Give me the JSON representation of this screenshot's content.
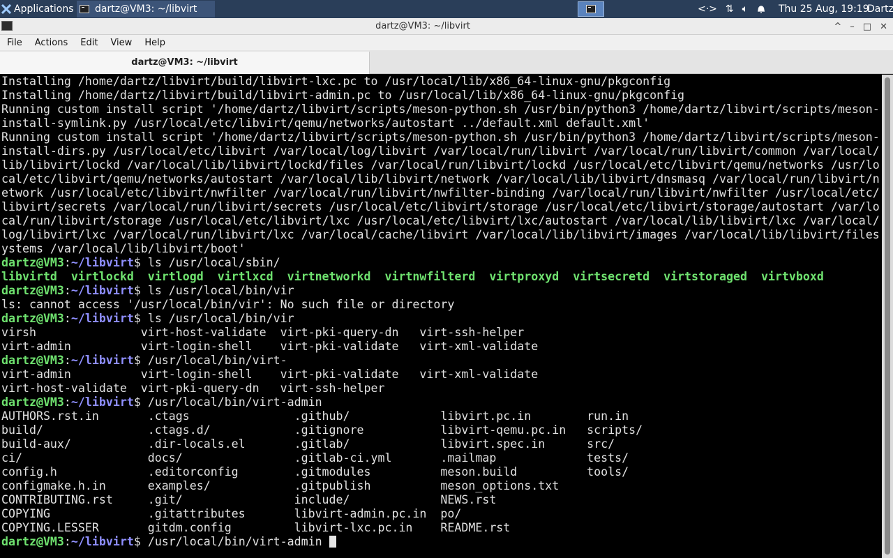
{
  "panel": {
    "apps_label": "Applications",
    "task_label": "dartz@VM3: ~/libvirt",
    "clock": "Thu 25 Aug, 19:19",
    "user": "Dartz",
    "tray_icons": [
      "network-arrows-icon",
      "updown-arrows-icon",
      "volume-icon",
      "bell-icon"
    ]
  },
  "window": {
    "title": "dartz@VM3: ~/libvirt",
    "btn_up": "^",
    "btn_min": "–",
    "btn_max": "□",
    "btn_close": "✕"
  },
  "menu": {
    "file": "File",
    "actions": "Actions",
    "edit": "Edit",
    "view": "View",
    "help": "Help"
  },
  "tab": {
    "label": "dartz@VM3: ~/libvirt"
  },
  "terminal": {
    "prompt_user": "dartz@VM3",
    "prompt_path": "~/libvirt",
    "lines": [
      {
        "kind": "out",
        "text": "Installing /home/dartz/libvirt/build/libvirt-lxc.pc to /usr/local/lib/x86_64-linux-gnu/pkgconfig"
      },
      {
        "kind": "out",
        "text": "Installing /home/dartz/libvirt/build/libvirt-admin.pc to /usr/local/lib/x86_64-linux-gnu/pkgconfig"
      },
      {
        "kind": "out",
        "text": "Running custom install script '/home/dartz/libvirt/scripts/meson-python.sh /usr/bin/python3 /home/dartz/libvirt/scripts/meson-"
      },
      {
        "kind": "out",
        "text": "install-symlink.py /usr/local/etc/libvirt/qemu/networks/autostart ../default.xml default.xml'"
      },
      {
        "kind": "out",
        "text": "Running custom install script '/home/dartz/libvirt/scripts/meson-python.sh /usr/bin/python3 /home/dartz/libvirt/scripts/meson-"
      },
      {
        "kind": "out",
        "text": "install-dirs.py /usr/local/etc/libvirt /var/local/log/libvirt /var/local/run/libvirt /var/local/run/libvirt/common /var/local/"
      },
      {
        "kind": "out",
        "text": "lib/libvirt/lockd /var/local/lib/libvirt/lockd/files /var/local/run/libvirt/lockd /usr/local/etc/libvirt/qemu/networks /usr/lo"
      },
      {
        "kind": "out",
        "text": "cal/etc/libvirt/qemu/networks/autostart /var/local/lib/libvirt/network /var/local/lib/libvirt/dnsmasq /var/local/run/libvirt/n"
      },
      {
        "kind": "out",
        "text": "etwork /usr/local/etc/libvirt/nwfilter /var/local/run/libvirt/nwfilter-binding /var/local/run/libvirt/nwfilter /usr/local/etc/"
      },
      {
        "kind": "out",
        "text": "libvirt/secrets /var/local/run/libvirt/secrets /usr/local/etc/libvirt/storage /usr/local/etc/libvirt/storage/autostart /var/lo"
      },
      {
        "kind": "out",
        "text": "cal/run/libvirt/storage /usr/local/etc/libvirt/lxc /usr/local/etc/libvirt/lxc/autostart /var/local/lib/libvirt/lxc /var/local/"
      },
      {
        "kind": "out",
        "text": "log/libvirt/lxc /var/local/run/libvirt/lxc /var/local/cache/libvirt /var/local/lib/libvirt/images /var/local/lib/libvirt/files"
      },
      {
        "kind": "out",
        "text": "ystems /var/local/lib/libvirt/boot'"
      },
      {
        "kind": "cmd",
        "text": "$ ls /usr/local/sbin/"
      },
      {
        "kind": "exe",
        "text": "libvirtd  virtlockd  virtlogd  virtlxcd  virtnetworkd  virtnwfilterd  virtproxyd  virtsecretd  virtstoraged  virtvboxd"
      },
      {
        "kind": "cmd",
        "text": "$ ls /usr/local/bin/vir"
      },
      {
        "kind": "out",
        "text": "ls: cannot access '/usr/local/bin/vir': No such file or directory"
      },
      {
        "kind": "cmd",
        "text": "$ ls /usr/local/bin/vir"
      },
      {
        "kind": "out",
        "text": "virsh               virt-host-validate  virt-pki-query-dn   virt-ssh-helper"
      },
      {
        "kind": "out",
        "text": "virt-admin          virt-login-shell    virt-pki-validate   virt-xml-validate"
      },
      {
        "kind": "cmd",
        "text": "$ /usr/local/bin/virt-"
      },
      {
        "kind": "out",
        "text": "virt-admin          virt-login-shell    virt-pki-validate   virt-xml-validate"
      },
      {
        "kind": "out",
        "text": "virt-host-validate  virt-pki-query-dn   virt-ssh-helper"
      },
      {
        "kind": "cmd",
        "text": "$ /usr/local/bin/virt-admin"
      },
      {
        "kind": "out",
        "text": "AUTHORS.rst.in       .ctags               .github/             libvirt.pc.in        run.in"
      },
      {
        "kind": "out",
        "text": "build/               .ctags.d/            .gitignore           libvirt-qemu.pc.in   scripts/"
      },
      {
        "kind": "out",
        "text": "build-aux/           .dir-locals.el       .gitlab/             libvirt.spec.in      src/"
      },
      {
        "kind": "out",
        "text": "ci/                  docs/                .gitlab-ci.yml       .mailmap             tests/"
      },
      {
        "kind": "out",
        "text": "config.h             .editorconfig        .gitmodules          meson.build          tools/"
      },
      {
        "kind": "out",
        "text": "configmake.h.in      examples/            .gitpublish          meson_options.txt"
      },
      {
        "kind": "out",
        "text": "CONTRIBUTING.rst     .git/                include/             NEWS.rst"
      },
      {
        "kind": "out",
        "text": "COPYING              .gitattributes       libvirt-admin.pc.in  po/"
      },
      {
        "kind": "out",
        "text": "COPYING.LESSER       gitdm.config         libvirt-lxc.pc.in    README.rst"
      },
      {
        "kind": "cmd",
        "text": "$ /usr/local/bin/virt-admin "
      }
    ]
  }
}
